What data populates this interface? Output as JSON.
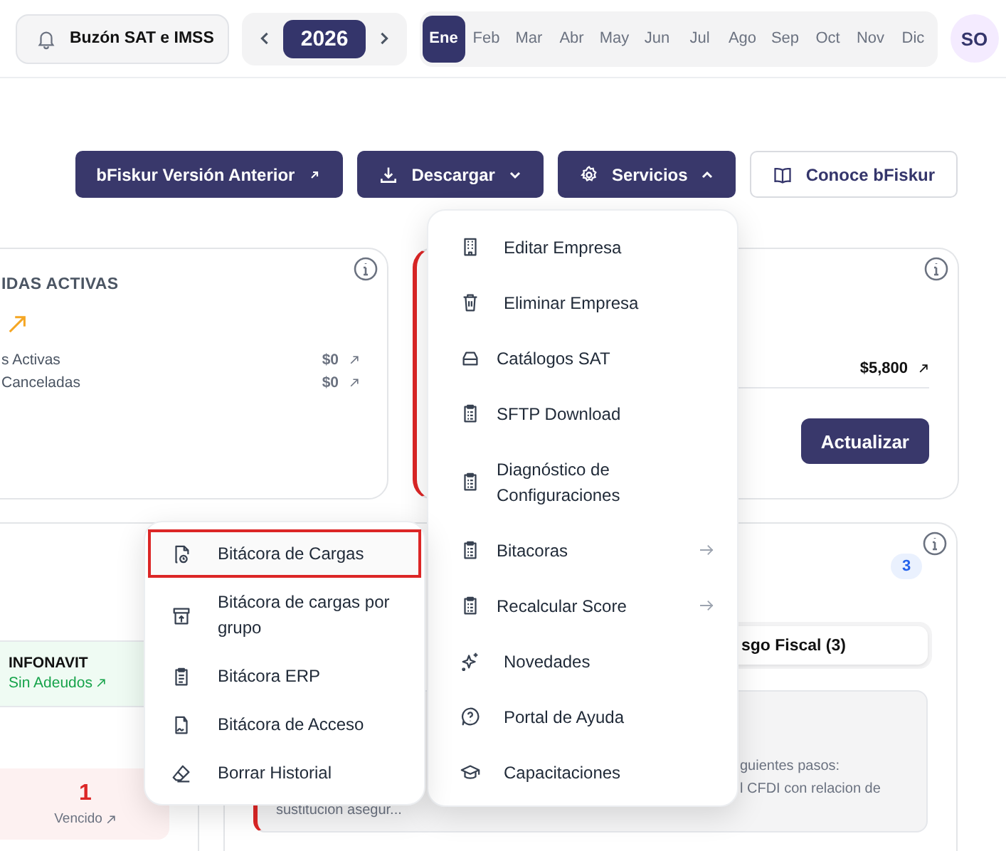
{
  "header": {
    "inbox_button": "Buzón SAT e IMSS",
    "year": "2026",
    "avatar": "SO",
    "months": [
      {
        "label": "Ene",
        "selected": true
      },
      {
        "label": "Feb",
        "selected": false
      },
      {
        "label": "Mar",
        "selected": false
      },
      {
        "label": "Abr",
        "selected": false
      },
      {
        "label": "May",
        "selected": false
      },
      {
        "label": "Jun",
        "selected": false
      },
      {
        "label": "Jul",
        "selected": false
      },
      {
        "label": "Ago",
        "selected": false
      },
      {
        "label": "Sep",
        "selected": false
      },
      {
        "label": "Oct",
        "selected": false
      },
      {
        "label": "Nov",
        "selected": false
      },
      {
        "label": "Dic",
        "selected": false
      }
    ]
  },
  "actions": [
    {
      "label": "bFiskur Versión Anterior",
      "kind": "external"
    },
    {
      "label": "Descargar",
      "kind": "download",
      "expanded": false
    },
    {
      "label": "Servicios",
      "kind": "services",
      "expanded": true
    },
    {
      "label": "Conoce bFiskur",
      "kind": "guide"
    }
  ],
  "sales_card": {
    "title": "IDAS ACTIVAS",
    "rows": [
      {
        "label": "s Activas",
        "amount": "$0"
      },
      {
        "label": "Canceladas",
        "amount": "$0"
      }
    ]
  },
  "balance_card": {
    "amount": "$5,800",
    "button": "Actualizar"
  },
  "compliance_card": {
    "infonavit": {
      "title": "INFONAVIT",
      "status": "Sin Adeudos"
    },
    "overdue": {
      "count": "1",
      "label": "Vencido"
    }
  },
  "risk_card": {
    "badge": "3",
    "tab": "sgo Fiscal (3)",
    "alert_lines": [
      "guientes pasos:",
      "l CFDI con relacion de",
      "sustitucion asegur..."
    ]
  },
  "services_menu": {
    "items": [
      {
        "label": "Editar Empresa",
        "submenu": false
      },
      {
        "label": "Eliminar Empresa",
        "submenu": false
      },
      {
        "label": "Catálogos SAT",
        "submenu": false
      },
      {
        "label": "SFTP Download",
        "submenu": false
      },
      {
        "label": "Diagnóstico de Configuraciones",
        "submenu": false
      },
      {
        "label": "Bitacoras",
        "submenu": true
      },
      {
        "label": "Recalcular Score",
        "submenu": true
      },
      {
        "label": "Novedades",
        "submenu": false
      },
      {
        "label": "Portal de Ayuda",
        "submenu": false
      },
      {
        "label": "Capacitaciones",
        "submenu": false
      }
    ]
  },
  "log_submenu": {
    "items": [
      {
        "label": "Bitácora de Cargas",
        "selected": true
      },
      {
        "label": "Bitácora de cargas por grupo",
        "selected": false
      },
      {
        "label": "Bitácora ERP",
        "selected": false
      },
      {
        "label": "Bitácora de Acceso",
        "selected": false
      },
      {
        "label": "Borrar Historial",
        "selected": false
      }
    ]
  }
}
